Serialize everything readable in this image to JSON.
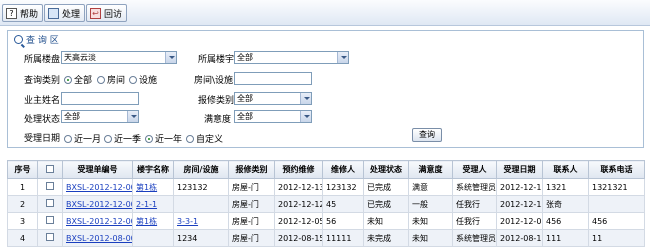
{
  "toolbar": {
    "help_label": "帮助",
    "process_label": "处理",
    "back_label": "回访"
  },
  "panel": {
    "title": "查 询 区",
    "property_label": "所属楼盘",
    "property_value": "天高云淡",
    "building_label": "所属楼宇",
    "building_value": "全部",
    "query_type_label": "查询类别",
    "query_type_options": [
      "全部",
      "房间",
      "设施"
    ],
    "room_facility_label": "房间\\设施",
    "owner_label": "业主姓名",
    "repair_type_label": "报修类别",
    "repair_type_value": "全部",
    "status_label": "处理状态",
    "status_value": "全部",
    "satisfaction_label": "满意度",
    "satisfaction_value": "全部",
    "date_label": "受理日期",
    "date_options": [
      "近一月",
      "近一季",
      "近一年",
      "自定义"
    ],
    "query_button": "查询"
  },
  "table": {
    "headers": [
      "序号",
      "",
      "受理单编号",
      "楼宇名称",
      "房间/设施",
      "报修类别",
      "预约维修",
      "维修人",
      "处理状态",
      "满意度",
      "受理人",
      "受理日期",
      "联系人",
      "联系电话"
    ],
    "rows": [
      {
        "no": "1",
        "code": "BXSL-2012-12-0012",
        "building": "第1栋",
        "room": "123132",
        "type": "房屋-门",
        "appoint": "2012-12-13",
        "repairer": "123132",
        "status": "已完成",
        "satisfaction": "满意",
        "handler": "系统管理员",
        "date": "2012-12-13",
        "contact": "1321",
        "phone": "1321321"
      },
      {
        "no": "2",
        "code": "BXSL-2012-12-0011",
        "building": "2-1-1",
        "room": "",
        "type": "房屋-门",
        "appoint": "2012-12-12",
        "repairer": "45",
        "status": "已完成",
        "satisfaction": "一般",
        "handler": "任我行",
        "date": "2012-12-12",
        "contact": "张奇",
        "phone": ""
      },
      {
        "no": "3",
        "code": "BXSL-2012-12-0010",
        "building": "第1栋",
        "room": "3-3-1",
        "type": "房屋-门",
        "appoint": "2012-12-05",
        "repairer": "56",
        "status": "未知",
        "satisfaction": "未知",
        "handler": "任我行",
        "date": "2012-12-05",
        "contact": "456",
        "phone": "456"
      },
      {
        "no": "4",
        "code": "BXSL-2012-08-0009",
        "building": "",
        "room": "1234",
        "type": "房屋-门",
        "appoint": "2012-08-15",
        "repairer": "11111",
        "status": "未完成",
        "satisfaction": "未知",
        "handler": "系统管理员",
        "date": "2012-08-15",
        "contact": "111",
        "phone": "11"
      }
    ]
  }
}
